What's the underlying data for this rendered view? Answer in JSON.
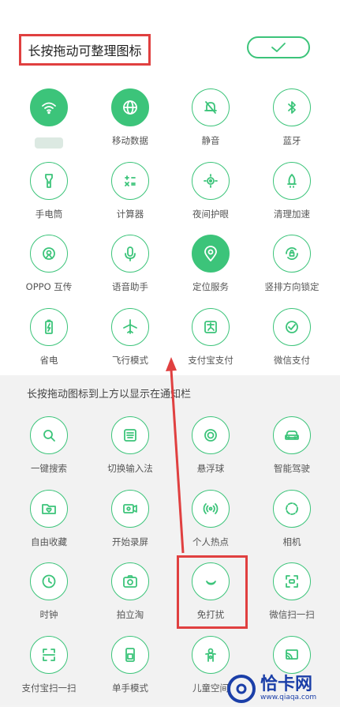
{
  "header": {
    "title": "长按拖动可整理图标",
    "done_icon": "check-icon"
  },
  "active_tiles": [
    {
      "label": "",
      "icon": "wifi-icon",
      "filled": true
    },
    {
      "label": "移动数据",
      "icon": "globe-icon",
      "filled": true
    },
    {
      "label": "静音",
      "icon": "bell-mute-icon",
      "filled": false
    },
    {
      "label": "蓝牙",
      "icon": "bluetooth-icon",
      "filled": false
    },
    {
      "label": "手电筒",
      "icon": "flashlight-icon",
      "filled": false
    },
    {
      "label": "计算器",
      "icon": "calculator-icon",
      "filled": false
    },
    {
      "label": "夜间护眼",
      "icon": "eye-sun-icon",
      "filled": false
    },
    {
      "label": "清理加速",
      "icon": "rocket-icon",
      "filled": false
    },
    {
      "label": "OPPO 互传",
      "icon": "share-icon",
      "filled": false
    },
    {
      "label": "语音助手",
      "icon": "microphone-icon",
      "filled": false
    },
    {
      "label": "定位服务",
      "icon": "location-icon",
      "filled": true
    },
    {
      "label": "竖排方向锁定",
      "icon": "rotation-lock-icon",
      "filled": false
    },
    {
      "label": "省电",
      "icon": "battery-icon",
      "filled": false
    },
    {
      "label": "飞行模式",
      "icon": "airplane-icon",
      "filled": false
    },
    {
      "label": "支付宝支付",
      "icon": "alipay-icon",
      "filled": false
    },
    {
      "label": "微信支付",
      "icon": "wechat-pay-icon",
      "filled": false
    }
  ],
  "inactive_section_label": "长按拖动图标到上方以显示在通知栏",
  "inactive_tiles": [
    {
      "label": "一键搜索",
      "icon": "search-icon"
    },
    {
      "label": "切换输入法",
      "icon": "keyboard-icon"
    },
    {
      "label": "悬浮球",
      "icon": "float-ball-icon"
    },
    {
      "label": "智能驾驶",
      "icon": "car-icon"
    },
    {
      "label": "自由收藏",
      "icon": "folder-heart-icon"
    },
    {
      "label": "开始录屏",
      "icon": "video-camera-icon"
    },
    {
      "label": "个人热点",
      "icon": "hotspot-icon"
    },
    {
      "label": "相机",
      "icon": "camera-ring-icon"
    },
    {
      "label": "时钟",
      "icon": "clock-icon"
    },
    {
      "label": "拍立淘",
      "icon": "camera-icon"
    },
    {
      "label": "免打扰",
      "icon": "moon-icon"
    },
    {
      "label": "微信扫一扫",
      "icon": "scan-wechat-icon"
    },
    {
      "label": "支付宝扫一扫",
      "icon": "scan-icon"
    },
    {
      "label": "单手模式",
      "icon": "one-hand-icon"
    },
    {
      "label": "儿童空间",
      "icon": "child-icon"
    },
    {
      "label": "",
      "icon": "cast-icon"
    }
  ],
  "watermark": {
    "name": "恰卡网",
    "url": "www.qiaqa.com"
  },
  "colors": {
    "accent": "#3cc47a",
    "highlight": "#e04040",
    "watermark": "#1b3fa8"
  }
}
